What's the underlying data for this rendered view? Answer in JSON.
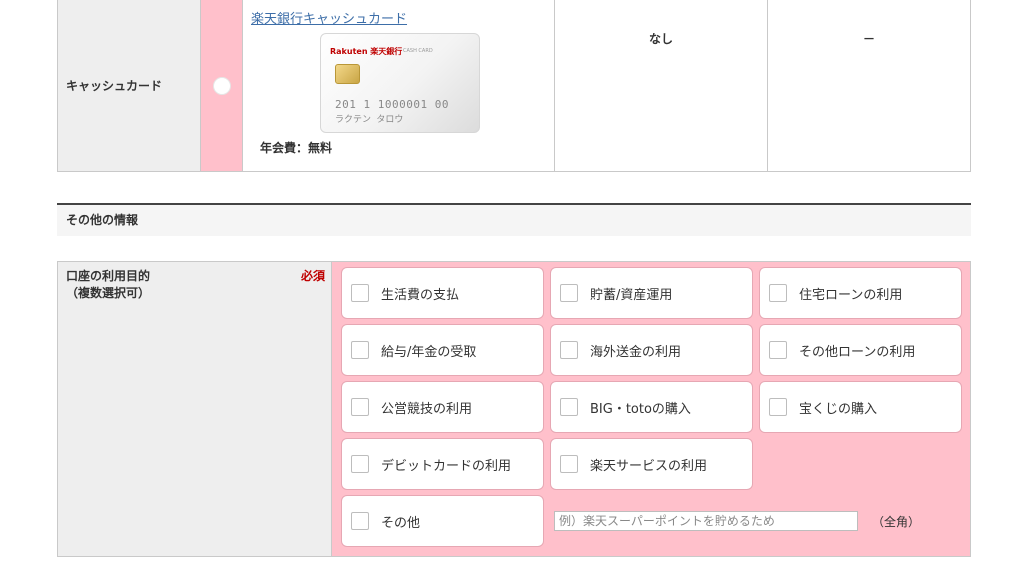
{
  "cash_card": {
    "label": "キャッシュカード",
    "card_link": "楽天銀行キャッシュカード",
    "card_brand": "Rakuten 楽天銀行",
    "card_brand_sub": "CASH CARD",
    "card_number": "201 1 1000001 00",
    "card_name": "ラクテン タロウ",
    "annual_fee": "年会費：無料",
    "col_fee": "なし",
    "col_other": "－"
  },
  "section": {
    "title": "その他の情報"
  },
  "purpose": {
    "label_line1": "口座の利用目的",
    "label_line2": "（複数選択可）",
    "required": "必須",
    "options": [
      "生活費の支払",
      "貯蓄/資産運用",
      "住宅ローンの利用",
      "給与/年金の受取",
      "海外送金の利用",
      "その他ローンの利用",
      "公営競技の利用",
      "BIG・totoの購入",
      "宝くじの購入",
      "デビットカードの利用",
      "楽天サービスの利用",
      "その他"
    ],
    "other_placeholder": "例）楽天スーパーポイントを貯めるため",
    "other_note": "（全角）"
  }
}
